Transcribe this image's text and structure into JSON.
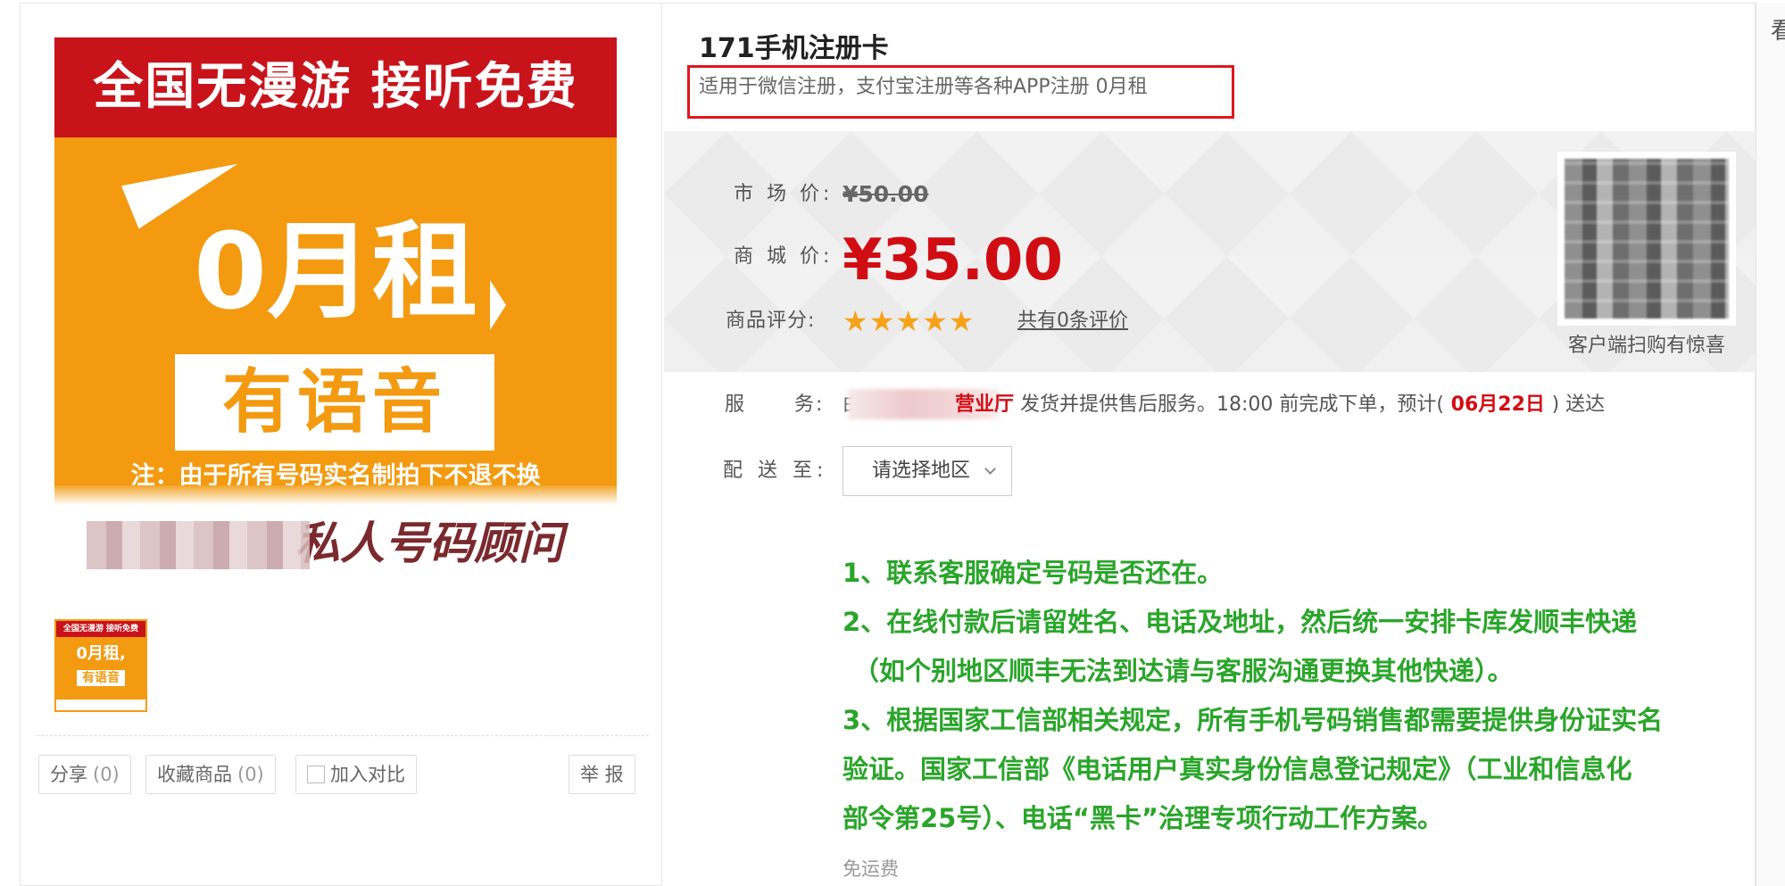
{
  "gallery": {
    "banner_top": "全国无漫游  接听免费",
    "big_text": "0月租",
    "voice_text": "有语音",
    "note_text": "注：由于所有号码实名制拍下不退不换",
    "handwriting_text": "私人号码顾问",
    "thumb_top": "全国无漫游 接听免费",
    "thumb_big": "0月租,",
    "thumb_voice": "有语音"
  },
  "actions": {
    "share_label": "分享",
    "share_count": "(0)",
    "favorite_label": "收藏商品",
    "favorite_count": "(0)",
    "compare_label": "加入对比",
    "report_label": "举 报"
  },
  "product": {
    "title": "171手机注册卡",
    "subtitle": "适用于微信注册，支付宝注册等各种APP注册 0月租"
  },
  "price": {
    "market_label": "市 场 价:",
    "market_value": "¥50.00",
    "mall_label": "商 城 价:",
    "mall_value": "¥35.00",
    "rating_label": "商品评分:",
    "stars": "★★★★★",
    "rating_value": 5,
    "review_link": "共有0条评价",
    "accent_color": "#d10d14",
    "star_color": "#f6a21a"
  },
  "qr": {
    "caption": "客户端扫购有惊喜"
  },
  "service": {
    "label": "服      务:",
    "prefix": "由",
    "hall": "营业厅",
    "text": " 发货并提供售后服务。18:00 前完成下单，预计(",
    "date": " 06月22日 ",
    "suffix": ") 送达"
  },
  "delivery": {
    "label": "配 送 至:",
    "select_value": "请选择地区"
  },
  "notes": {
    "line1": "1、联系客服确定号码是否还在。",
    "line2": "2、在线付款后请留姓名、电话及地址，然后统一安排卡库发顺丰快递",
    "line3": "（如个别地区顺丰无法到达请与客服沟通更换其他快递）。",
    "line4": "3、根据国家工信部相关规定，所有手机号码销售都需要提供身份证实名",
    "line5": "验证。国家工信部《电话用户真实身份信息登记规定》（工业和信息化",
    "line6": "部令第25号）、电话“黑卡”治理专项行动工作方案。",
    "color": "#2aa52a"
  },
  "shipping": {
    "free": "免运费"
  },
  "edge": {
    "char": "看"
  }
}
